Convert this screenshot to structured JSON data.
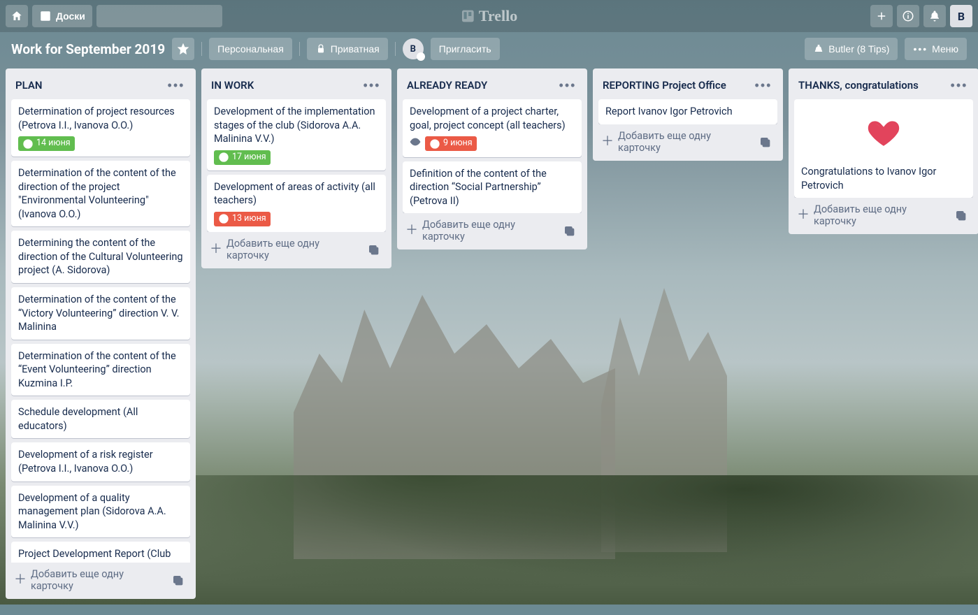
{
  "header": {
    "boards_label": "Доски",
    "search_placeholder": "",
    "brand": "Trello",
    "avatar_initial": "В"
  },
  "board_bar": {
    "title": "Work for September 2019",
    "personal_label": "Персональная",
    "private_label": "Приватная",
    "member_initial": "В",
    "invite_label": "Пригласить",
    "butler_label": "Butler (8 Tips)",
    "menu_label": "Меню"
  },
  "lists": [
    {
      "title": "PLAN",
      "add_card": "Добавить еще одну карточку",
      "cards": [
        {
          "text": "Determination of project resources (Petrova I.I., Ivanova O.O.)",
          "date": "14 июня",
          "date_style": "green"
        },
        {
          "text": "Determination of the content of the direction of the project \"Environmental Volunteering\" (Ivanova O.O.)"
        },
        {
          "text": "Determining the content of the direction of the Cultural Volunteering project (A. Sidorova)"
        },
        {
          "text": "Determination of the content of the “Victory Volunteering” direction V. V. Malinina"
        },
        {
          "text": "Determination of the content of the “Event Volunteering” direction Kuzmina I.P."
        },
        {
          "text": "Schedule development (All educators)"
        },
        {
          "text": "Development of a risk register (Petrova I.I., Ivanova O.O.)"
        },
        {
          "text": "Development of a quality management plan (Sidorova A.A. Malinina V.V.)"
        },
        {
          "text": "Project Development Report (Club President)"
        }
      ]
    },
    {
      "title": "IN WORK",
      "add_card": "Добавить еще одну карточку",
      "cards": [
        {
          "text": "Development of the implementation stages of the club (Sidorova A.A. Malinina V.V.)",
          "date": "17 июня",
          "date_style": "green"
        },
        {
          "text": "Development of areas of activity (all teachers)",
          "date": "13 июня",
          "date_style": "red"
        }
      ]
    },
    {
      "title": "ALREADY READY",
      "add_card": "Добавить еще одну карточку",
      "cards": [
        {
          "text": "Development of a project charter, goal, project concept (all teachers)",
          "date": "9 июня",
          "date_style": "red",
          "watched": true
        },
        {
          "text": "Definition of the content of the direction “Social Partnership” (Petrova II)"
        }
      ]
    },
    {
      "title": "REPORTING Project Office",
      "add_card": "Добавить еще одну карточку",
      "cards": [
        {
          "text": "Report Ivanov Igor Petrovich"
        }
      ]
    },
    {
      "title": "THANKS, congratulations",
      "add_card": "Добавить еще одну карточку",
      "cards": [
        {
          "text": "Congratulations to Ivanov Igor Petrovich",
          "has_heart": true
        }
      ]
    }
  ]
}
